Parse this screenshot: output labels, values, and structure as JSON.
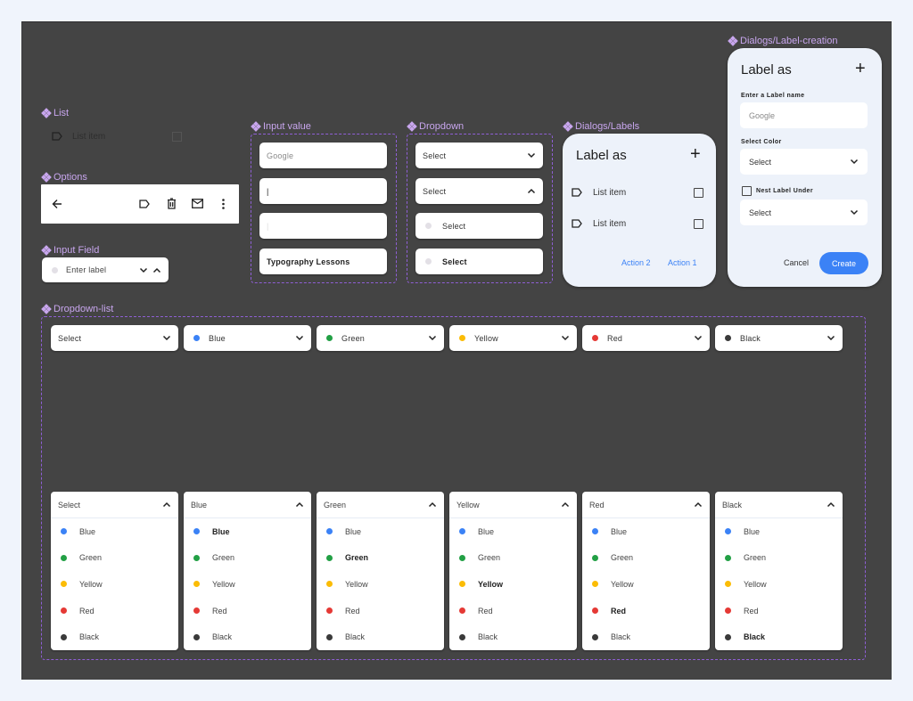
{
  "sections": {
    "list": "List",
    "options": "Options",
    "input_field": "Input Field",
    "input_value": "Input value",
    "dropdown": "Dropdown",
    "dialogs_labels": "Dialogs/Labels",
    "dialogs_label_creation": "Dialogs/Label-creation",
    "dropdown_list": "Dropdown-list"
  },
  "list": {
    "item_label": "List item",
    "icon": "label-icon"
  },
  "options": {
    "icons": [
      "arrow-back-icon",
      "label-icon",
      "trash-icon",
      "mail-icon",
      "more-vert-icon"
    ]
  },
  "input_field": {
    "placeholder": "Enter label"
  },
  "input_value": {
    "fields": [
      {
        "value": "Google",
        "state": "placeholder"
      },
      {
        "value": "|",
        "state": "focused"
      },
      {
        "value": "|",
        "state": "faint-cursor"
      },
      {
        "value": "Typography Lessons",
        "state": "filled"
      }
    ]
  },
  "dropdown": {
    "items": [
      {
        "label": "Select",
        "chevron": "down"
      },
      {
        "label": "Select",
        "chevron": "up"
      },
      {
        "label": "Select",
        "dot": true
      },
      {
        "label": "Select",
        "dot": true,
        "bold": true
      }
    ]
  },
  "dialog_labels": {
    "title": "Label as",
    "items": [
      "List item",
      "List item"
    ],
    "action2": "Action 2",
    "action1": "Action 1"
  },
  "dialog_creation": {
    "title": "Label as",
    "name_label": "Enter a Label name",
    "name_placeholder": "Google",
    "color_label": "Select Color",
    "color_value": "Select",
    "nest_label": "Nest Label Under",
    "nest_value": "Select",
    "cancel": "Cancel",
    "create": "Create",
    "accent": "#3b82f6"
  },
  "colors": {
    "Blue": "#3b82f6",
    "Green": "#22a045",
    "Yellow": "#fbbc05",
    "Red": "#e53935",
    "Black": "#3a3a3a"
  },
  "dropdown_list": {
    "options": [
      "Blue",
      "Green",
      "Yellow",
      "Red",
      "Black"
    ],
    "collapsed": [
      "Select",
      "Blue",
      "Green",
      "Yellow",
      "Red",
      "Black"
    ],
    "expanded": [
      "Select",
      "Blue",
      "Green",
      "Yellow",
      "Red",
      "Black"
    ]
  }
}
